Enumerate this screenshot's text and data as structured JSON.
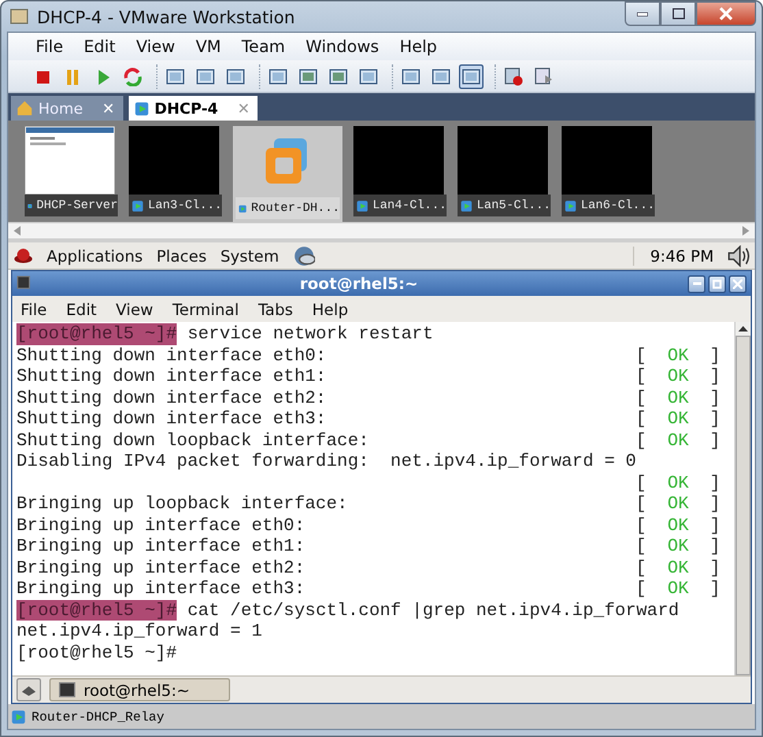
{
  "window": {
    "title": "DHCP-4 - VMware Workstation"
  },
  "menu": [
    "File",
    "Edit",
    "View",
    "VM",
    "Team",
    "Windows",
    "Help"
  ],
  "toolbar": {
    "groups": [
      [
        {
          "kind": "stop",
          "selected": false
        },
        {
          "kind": "pause",
          "selected": false
        },
        {
          "kind": "play",
          "selected": false
        },
        {
          "kind": "reset",
          "selected": false
        }
      ],
      [
        {
          "kind": "window",
          "selected": false
        },
        {
          "kind": "window",
          "selected": false
        },
        {
          "kind": "window",
          "selected": false
        }
      ],
      [
        {
          "kind": "window",
          "selected": false
        },
        {
          "kind": "screen",
          "selected": false
        },
        {
          "kind": "screen",
          "selected": false
        },
        {
          "kind": "window",
          "selected": false
        }
      ],
      [
        {
          "kind": "window",
          "selected": false
        },
        {
          "kind": "window",
          "selected": false
        },
        {
          "kind": "window",
          "selected": true
        }
      ],
      [
        {
          "kind": "record",
          "selected": false
        },
        {
          "kind": "replay",
          "selected": false
        }
      ]
    ]
  },
  "tabs": [
    {
      "label": "Home",
      "kind": "home",
      "close": "✕",
      "selected": false
    },
    {
      "label": "DHCP-4",
      "kind": "vm",
      "close": "✕",
      "selected": true
    }
  ],
  "thumbnails": [
    {
      "label": "DHCP-Server",
      "kind": "screen",
      "selected": false
    },
    {
      "label": "Lan3-Cl...",
      "kind": "black",
      "selected": false
    },
    {
      "label": "Router-DH...",
      "kind": "logo",
      "selected": true
    },
    {
      "label": "Lan4-Cl...",
      "kind": "black",
      "selected": false
    },
    {
      "label": "Lan5-Cl...",
      "kind": "black",
      "selected": false
    },
    {
      "label": "Lan6-Cl...",
      "kind": "black",
      "selected": false
    }
  ],
  "panel": {
    "menus": [
      "Applications",
      "Places",
      "System"
    ],
    "clock": "9:46 PM"
  },
  "terminal": {
    "title": "root@rhel5:~",
    "menu": [
      "File",
      "Edit",
      "View",
      "Terminal",
      "Tabs",
      "Help"
    ],
    "lines": [
      {
        "kind": "prompt",
        "prompt": "[root@rhel5 ~]#",
        "text": "service network restart"
      },
      {
        "kind": "output",
        "text": "Shutting down interface eth0:",
        "status": {
          "left": "[",
          "label": "OK",
          "right": "]"
        }
      },
      {
        "kind": "output",
        "text": "Shutting down interface eth1:",
        "status": {
          "left": "[",
          "label": "OK",
          "right": "]"
        }
      },
      {
        "kind": "output",
        "text": "Shutting down interface eth2:",
        "status": {
          "left": "[",
          "label": "OK",
          "right": "]"
        }
      },
      {
        "kind": "output",
        "text": "Shutting down interface eth3:",
        "status": {
          "left": "[",
          "label": "OK",
          "right": "]"
        }
      },
      {
        "kind": "output",
        "text": "Shutting down loopback interface:",
        "status": {
          "left": "[",
          "label": "OK",
          "right": "]"
        }
      },
      {
        "kind": "output",
        "text": "Disabling IPv4 packet forwarding:  net.ipv4.ip_forward = 0"
      },
      {
        "kind": "output",
        "status": {
          "left": "[",
          "label": "OK",
          "right": "]"
        }
      },
      {
        "kind": "output",
        "text": "Bringing up loopback interface:",
        "status": {
          "left": "[",
          "label": "OK",
          "right": "]"
        }
      },
      {
        "kind": "output",
        "text": "Bringing up interface eth0:",
        "status": {
          "left": "[",
          "label": "OK",
          "right": "]"
        }
      },
      {
        "kind": "output",
        "text": "Bringing up interface eth1:",
        "status": {
          "left": "[",
          "label": "OK",
          "right": "]"
        }
      },
      {
        "kind": "output",
        "text": "Bringing up interface eth2:",
        "status": {
          "left": "[",
          "label": "OK",
          "right": "]"
        }
      },
      {
        "kind": "output",
        "text": "Bringing up interface eth3:",
        "status": {
          "left": "[",
          "label": "OK",
          "right": "]"
        }
      },
      {
        "kind": "prompt",
        "prompt": "[root@rhel5 ~]#",
        "text": "cat /etc/sysctl.conf |grep net.ipv4.ip_forward"
      },
      {
        "kind": "output",
        "text": "net.ipv4.ip_forward = 1"
      },
      {
        "kind": "output",
        "text": "[root@rhel5 ~]#"
      }
    ]
  },
  "taskbar": {
    "items": [
      {
        "label": "root@rhel5:~",
        "selected": true
      }
    ]
  },
  "status_bar": {
    "text": "Router-DHCP_Relay"
  }
}
